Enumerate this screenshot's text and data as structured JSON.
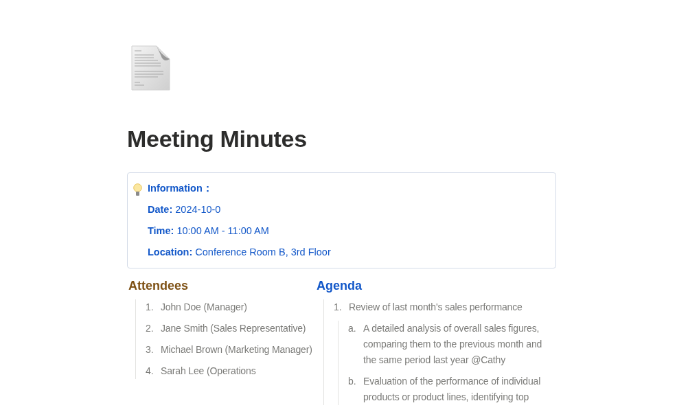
{
  "page": {
    "title": "Meeting Minutes"
  },
  "callout": {
    "heading": "Information：",
    "fields": [
      {
        "label": "Date:",
        "value": "2024-10-0"
      },
      {
        "label": "Time:",
        "value": "10:00 AM - 11:00 AM"
      },
      {
        "label": "Location:",
        "value": "Conference Room B, 3rd Floor"
      }
    ]
  },
  "columns": [
    {
      "heading": "Attendees",
      "color": "#7f5216",
      "items": [
        {
          "marker": "1.",
          "text": "John Doe (Manager)"
        },
        {
          "marker": "2.",
          "text": "Jane Smith (Sales Representative)"
        },
        {
          "marker": "3.",
          "text": "Michael Brown (Marketing Manager)"
        },
        {
          "marker": "4.",
          "text": "Sarah Lee (Operations"
        }
      ]
    },
    {
      "heading": "Agenda",
      "color": "#1358c9",
      "items": [
        {
          "marker": "1.",
          "text": "Review of last month's sales performance",
          "children": [
            {
              "marker": "a.",
              "text": "A detailed analysis of overall sales figures, comparing them to the previous month and the same period last year @Cathy"
            },
            {
              "marker": "b.",
              "text": "Evaluation of the performance of individual products or product lines, identifying top"
            }
          ]
        }
      ]
    }
  ]
}
